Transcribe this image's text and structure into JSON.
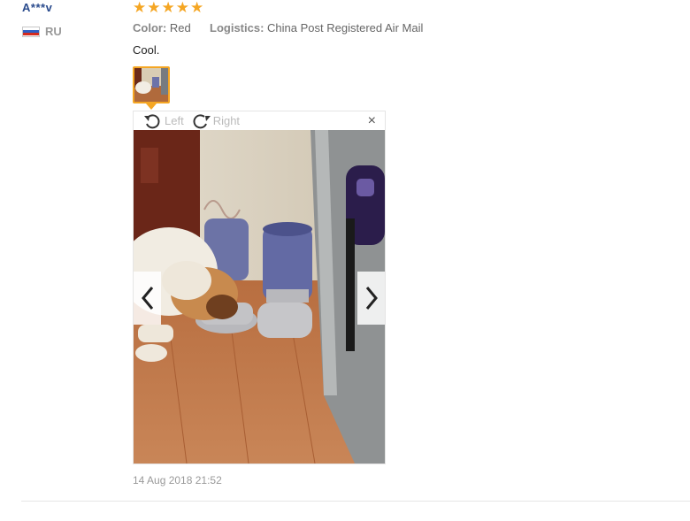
{
  "review": {
    "reviewer_name": "A***v",
    "country_code": "RU",
    "flag_colors": [
      "#ffffff",
      "#2f5ec4",
      "#d52b1e"
    ],
    "rating": 5,
    "star_color": "#f5a623",
    "color_label": "Color:",
    "color_value": "Red",
    "logistics_label": "Logistics:",
    "logistics_value": "China Post Registered Air Mail",
    "text": "Cool.",
    "date": "14 Aug 2018 21:52"
  },
  "viewer": {
    "rotate_left_label": "Left",
    "rotate_right_label": "Right",
    "close_glyph": "×",
    "prev_icon": "chevron-left-icon",
    "next_icon": "chevron-right-icon"
  }
}
